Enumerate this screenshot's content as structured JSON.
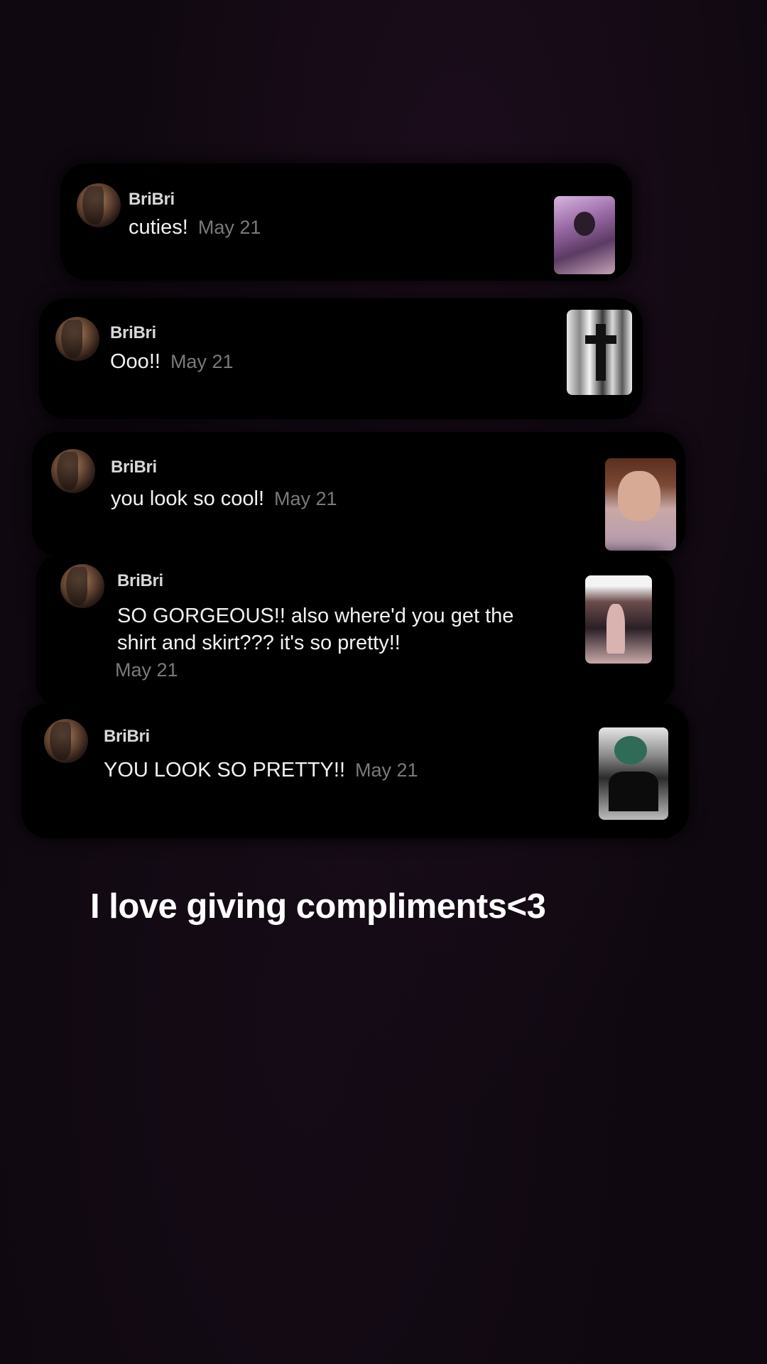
{
  "comments": [
    {
      "user": "BriBri",
      "text": "cuties!",
      "date": "May 21",
      "thumb": "selfie-thumbnail"
    },
    {
      "user": "BriBri",
      "text": "Ooo!!",
      "date": "May 21",
      "thumb": "cross-photo-thumbnail"
    },
    {
      "user": "BriBri",
      "text": "you look so cool!",
      "date": "May 21",
      "thumb": "portrait-thumbnail"
    },
    {
      "user": "BriBri",
      "text": "SO GORGEOUS!! also where'd you get the shirt and skirt??? it's so pretty!!",
      "date": "May 21",
      "thumb": "mirror-photo-thumbnail"
    },
    {
      "user": "BriBri",
      "text": "YOU LOOK SO PRETTY!!",
      "date": "May 21",
      "thumb": "selfie-thumbnail"
    }
  ],
  "caption": "I love giving compliments<3"
}
